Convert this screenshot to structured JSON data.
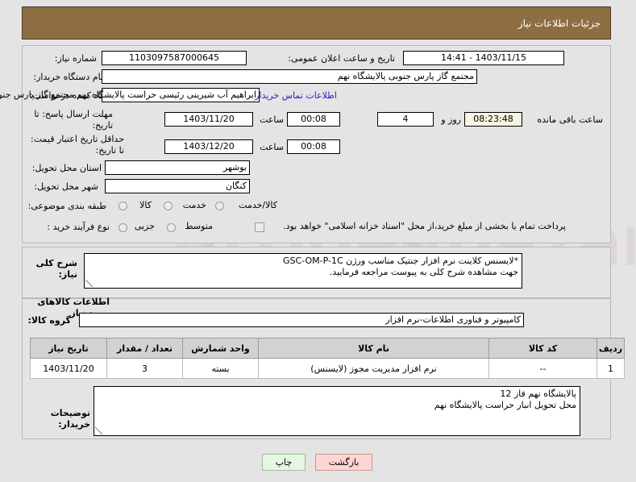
{
  "header": {
    "title": "جزئیات اطلاعات نیاز"
  },
  "top_form": {
    "need_number_label": "شماره نیاز:",
    "need_number_value": "1103097587000645",
    "announce_datetime_label": "تاریخ و ساعت اعلان عمومی:",
    "announce_datetime_value": "1403/11/15 - 14:41",
    "buyer_org_label": "نام دستگاه خریدار:",
    "buyer_org_value": "مجتمع گاز پارس جنوبی  پالایشگاه نهم",
    "creator_label": "ایجاد کننده درخواست:",
    "creator_value": "ابراهیم آب شیرینی رئیسی حراست پالایشگاه نهم مجتمع گاز پارس جنوبی  پالایش",
    "buyer_contact_link": "اطلاعات تماس خریدار",
    "deadline_label": "مهلت ارسال پاسخ: تا تاریخ:",
    "deadline_date": "1403/11/20",
    "deadline_hour_label": "ساعت",
    "deadline_hour": "00:08",
    "remaining_days": "4",
    "remaining_days_label": "روز و",
    "remaining_time": "08:23:48",
    "remaining_time_label": "ساعت باقی مانده",
    "price_validity_label": "حداقل تاریخ اعتبار قیمت: تا تاریخ:",
    "price_validity_date": "1403/12/20",
    "price_validity_hour_label": "ساعت",
    "price_validity_hour": "00:08",
    "province_label": "استان محل تحویل:",
    "province_value": "بوشهر",
    "city_label": "شهر محل تحویل:",
    "city_value": "کنگان",
    "category_label": "طبقه بندی موضوعی:",
    "category_options": [
      "کالا",
      "خدمت",
      "کالا/خدمت"
    ],
    "process_type_label": "نوع فرآیند خرید :",
    "process_type_options": [
      "جزیی",
      "متوسط"
    ],
    "treasury_note": "پرداخت تمام یا بخشی از مبلغ خرید،از محل \"اسناد خزانه اسلامی\" خواهد بود."
  },
  "description": {
    "label": "شرح کلی نیاز:",
    "value": "*لایسنس کلاینت نرم افزار جنتیک مناسب ورژن GSC-OM-P-1C\nجهت مشاهده شرح کلی به پیوست مراجعه فرمایید."
  },
  "goods": {
    "section_title": "اطلاعات کالاهای مورد نیاز",
    "group_label": "گروه کالا:",
    "group_value": "کامپیوتر و فناوری اطلاعات-نرم افزار",
    "table": {
      "columns": [
        "ردیف",
        "کد کالا",
        "نام کالا",
        "واحد شمارش",
        "تعداد / مقدار",
        "تاریخ نیاز"
      ],
      "rows": [
        {
          "row": "1",
          "code": "--",
          "name": "نرم افزار مدیریت مجوز (لایسنس)",
          "unit": "بسته",
          "quantity": "3",
          "need_date": "1403/11/20"
        }
      ]
    },
    "notes_label": "توضیحات خریدار:",
    "notes_value": "پالایشگاه نهم  فاز 12\nمحل تحویل انبار حراست پالایشگاه نهم"
  },
  "footer": {
    "back_button": "بازگشت",
    "print_button": "چاپ"
  },
  "watermark": {
    "text": "Artidevbazar.net"
  }
}
